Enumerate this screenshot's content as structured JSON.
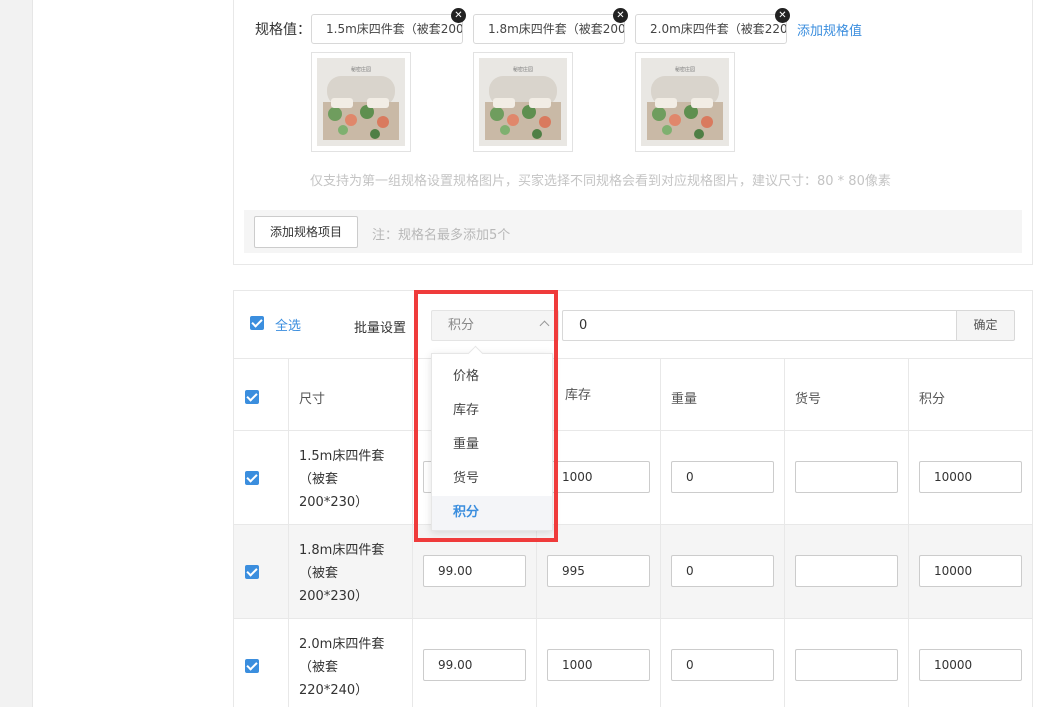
{
  "spec": {
    "label": "规格值：",
    "values": [
      {
        "text": "1.5m床四件套（被套200"
      },
      {
        "text": "1.8m床四件套（被套200"
      },
      {
        "text": "2.0m床四件套（被套220"
      }
    ],
    "image_logo_text": "秘密庄园",
    "add_value_link": "添加规格值",
    "hint": "仅支持为第一组规格设置规格图片，买家选择不同规格会看到对应规格图片，建议尺寸：80 * 80像素",
    "add_item_button": "添加规格项目",
    "add_item_note": "注：规格名最多添加5个"
  },
  "batch": {
    "select_all": "全选",
    "label": "批量设置",
    "selected_option": "积分",
    "value": "0",
    "confirm": "确定",
    "options": [
      "价格",
      "库存",
      "重量",
      "货号",
      "积分"
    ]
  },
  "table": {
    "headers": {
      "size": "尺寸",
      "stock": "库存",
      "weight": "重量",
      "sku_code": "货号",
      "points": "积分"
    },
    "rows": [
      {
        "size": "1.5m床四件套（被套200*230）",
        "price": "",
        "stock": "1000",
        "weight": "0",
        "sku_code": "",
        "points": "10000"
      },
      {
        "size": "1.8m床四件套（被套200*230）",
        "price": "99.00",
        "stock": "995",
        "weight": "0",
        "sku_code": "",
        "points": "10000"
      },
      {
        "size": "2.0m床四件套（被套220*240）",
        "price": "99.00",
        "stock": "1000",
        "weight": "0",
        "sku_code": "",
        "points": "10000"
      }
    ]
  },
  "colors": {
    "accent": "#3b8ede",
    "highlight": "#ef3b3b"
  }
}
